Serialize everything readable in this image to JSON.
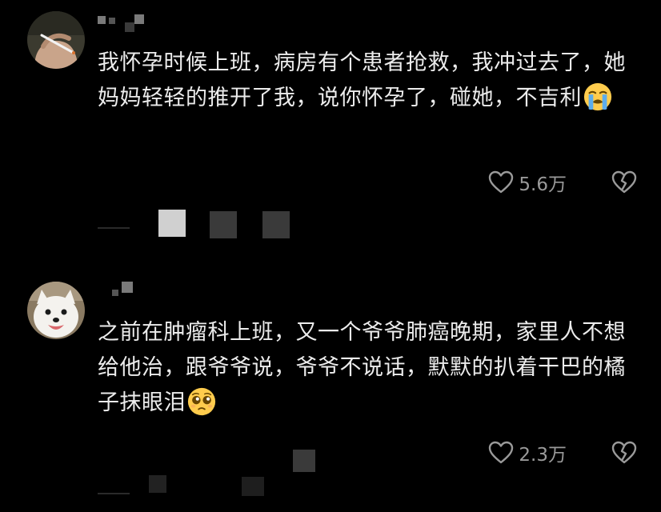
{
  "comments": [
    {
      "text": "我怀孕时候上班，病房有个患者抢救，我冲过去了，她妈妈轻轻的推开了我，说你怀孕了，碰她，不吉利",
      "emoji": "loudly-crying-face",
      "likes": "5.6万",
      "avatar": "hand-holding-cigarette-avatar"
    },
    {
      "text": "之前在肿瘤科上班，又一个爷爷肺癌晚期，家里人不想给他治，跟爷爷说，爷爷不说话，默默的扒着干巴的橘子抹眼泪",
      "emoji": "pleading-face",
      "likes": "2.3万",
      "avatar": "white-dog-avatar"
    }
  ],
  "colors": {
    "background": "#000000",
    "text": "#ececec",
    "muted": "#9a9a9a"
  },
  "icons": {
    "like": "heart-outline-icon",
    "dislike": "broken-heart-icon"
  }
}
